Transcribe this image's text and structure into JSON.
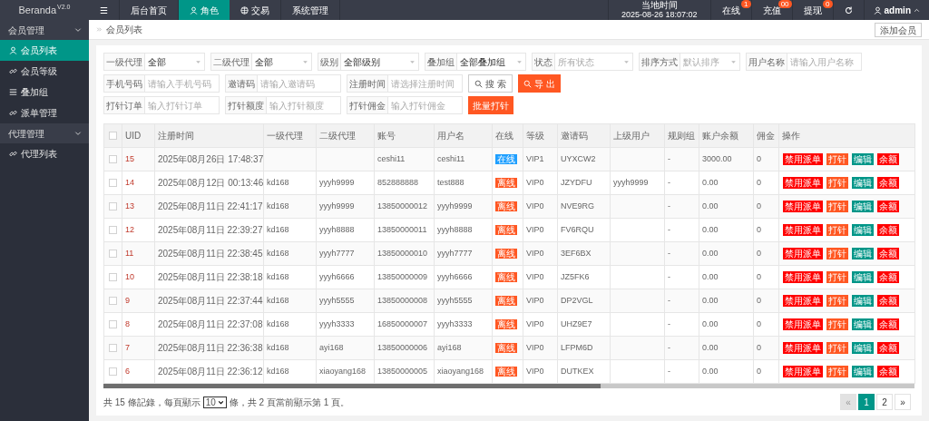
{
  "brand": {
    "name": "Beranda",
    "version": "V2.0"
  },
  "top_nav": {
    "items": [
      {
        "kind": "menu",
        "label": "☰",
        "selected": false
      },
      {
        "kind": "text",
        "label": "后台首页",
        "selected": false
      },
      {
        "kind": "person",
        "label": "角色",
        "selected": true
      },
      {
        "kind": "globe",
        "label": "交易",
        "selected": false
      },
      {
        "kind": "text",
        "label": "系统管理",
        "selected": false
      }
    ],
    "clock_label": "当地时间",
    "clock": "2025-08-26 18:07:02",
    "counters": [
      {
        "label": "在线",
        "badge": "1"
      },
      {
        "label": "充值",
        "badge": "00"
      },
      {
        "label": "提现",
        "badge": "0"
      }
    ],
    "user": "admin"
  },
  "sidebar": {
    "groups": [
      {
        "label": "会员管理",
        "expanded": true,
        "children": [
          {
            "kind": "person",
            "label": "会员列表",
            "selected": true
          },
          {
            "kind": "link",
            "label": "会员等级",
            "selected": false
          },
          {
            "kind": "list",
            "label": "叠加组",
            "selected": false
          },
          {
            "kind": "link",
            "label": "派单管理",
            "selected": false
          }
        ]
      },
      {
        "label": "代理管理",
        "expanded": true,
        "children": [
          {
            "kind": "link",
            "label": "代理列表",
            "selected": false
          }
        ]
      }
    ]
  },
  "breadcrumb": "会员列表",
  "add_button": "添加会员",
  "filters": [
    [
      {
        "kind": "select",
        "label": "一级代理",
        "value": "全部"
      },
      {
        "kind": "select",
        "label": "二级代理",
        "value": "全部"
      },
      {
        "kind": "select",
        "label": "级别",
        "value": "全部级别"
      },
      {
        "kind": "select",
        "label": "叠加组",
        "value": "全部叠加组"
      },
      {
        "kind": "select",
        "label": "状态",
        "placeholder": "所有状态"
      },
      {
        "kind": "select",
        "label": "排序方式",
        "placeholder": "默认排序"
      },
      {
        "kind": "input",
        "label": "用户名称",
        "placeholder": "请输入用户名称"
      }
    ],
    [
      {
        "kind": "input",
        "label": "手机号码",
        "placeholder": "请输入手机号码"
      },
      {
        "kind": "input",
        "label": "邀请码",
        "placeholder": "请输入邀请码"
      },
      {
        "kind": "input",
        "label": "注册时间",
        "placeholder": "请选择注册时间"
      },
      {
        "kind": "search",
        "label": "搜 索"
      },
      {
        "kind": "export",
        "label": "导 出"
      }
    ],
    [
      {
        "kind": "input",
        "label": "打针订单",
        "placeholder": "输入打针订单"
      },
      {
        "kind": "input",
        "label": "打针额度",
        "placeholder": "输入打针额度"
      },
      {
        "kind": "input",
        "label": "打针佣金",
        "placeholder": "输入打针佣金"
      },
      {
        "kind": "batch",
        "label": "批量打针"
      }
    ]
  ],
  "table": {
    "header_checked": false,
    "columns": [
      "UID",
      "注册时间",
      "一级代理",
      "二级代理",
      "账号",
      "用户名",
      "在线",
      "等级",
      "邀请码",
      "上级用户",
      "规则组",
      "账户余额",
      "佣金",
      "操作"
    ],
    "rows": [
      {
        "checked": false,
        "uid": "15",
        "time": "2025年08月26日 17:48:37",
        "account": "ceshi11",
        "username": "ceshi11",
        "online": true,
        "status": "在线",
        "level": "VIP1",
        "code": "UYXCW2",
        "rule": "-",
        "balance": "3000.00",
        "commission": "0",
        "actions": [
          {
            "kind": "disable",
            "label": "禁用派单"
          },
          {
            "kind": "inject",
            "label": "打针"
          },
          {
            "kind": "edit",
            "label": "编辑"
          },
          {
            "kind": "balance",
            "label": "余额"
          }
        ]
      },
      {
        "checked": false,
        "uid": "14",
        "time": "2025年08月12日 00:13:46",
        "agent1": "kd168",
        "agent2": "yyyh9999",
        "account": "852888888",
        "username": "test888",
        "online": false,
        "status": "离线",
        "level": "VIP0",
        "code": "JZYDFU",
        "parent": "yyyh9999",
        "rule": "-",
        "balance": "0.00",
        "commission": "0",
        "actions": [
          {
            "kind": "disable",
            "label": "禁用派单"
          },
          {
            "kind": "inject",
            "label": "打针"
          },
          {
            "kind": "edit",
            "label": "编辑"
          },
          {
            "kind": "balance",
            "label": "余额"
          }
        ]
      },
      {
        "checked": false,
        "uid": "13",
        "time": "2025年08月11日 22:41:17",
        "agent1": "kd168",
        "agent2": "yyyh9999",
        "account": "13850000012",
        "username": "yyyh9999",
        "online": false,
        "status": "离线",
        "level": "VIP0",
        "code": "NVE9RG",
        "rule": "-",
        "balance": "0.00",
        "commission": "0",
        "actions": [
          {
            "kind": "disable",
            "label": "禁用派单"
          },
          {
            "kind": "inject",
            "label": "打针"
          },
          {
            "kind": "edit",
            "label": "编辑"
          },
          {
            "kind": "balance",
            "label": "余额"
          }
        ]
      },
      {
        "checked": false,
        "uid": "12",
        "time": "2025年08月11日 22:39:27",
        "agent1": "kd168",
        "agent2": "yyyh8888",
        "account": "13850000011",
        "username": "yyyh8888",
        "online": false,
        "status": "离线",
        "level": "VIP0",
        "code": "FV6RQU",
        "rule": "-",
        "balance": "0.00",
        "commission": "0",
        "actions": [
          {
            "kind": "disable",
            "label": "禁用派单"
          },
          {
            "kind": "inject",
            "label": "打针"
          },
          {
            "kind": "edit",
            "label": "编辑"
          },
          {
            "kind": "balance",
            "label": "余额"
          }
        ]
      },
      {
        "checked": false,
        "uid": "11",
        "time": "2025年08月11日 22:38:45",
        "agent1": "kd168",
        "agent2": "yyyh7777",
        "account": "13850000010",
        "username": "yyyh7777",
        "online": false,
        "status": "离线",
        "level": "VIP0",
        "code": "3EF6BX",
        "rule": "-",
        "balance": "0.00",
        "commission": "0",
        "actions": [
          {
            "kind": "disable",
            "label": "禁用派单"
          },
          {
            "kind": "inject",
            "label": "打针"
          },
          {
            "kind": "edit",
            "label": "编辑"
          },
          {
            "kind": "balance",
            "label": "余额"
          }
        ]
      },
      {
        "checked": false,
        "uid": "10",
        "time": "2025年08月11日 22:38:18",
        "agent1": "kd168",
        "agent2": "yyyh6666",
        "account": "13850000009",
        "username": "yyyh6666",
        "online": false,
        "status": "离线",
        "level": "VIP0",
        "code": "JZ5FK6",
        "rule": "-",
        "balance": "0.00",
        "commission": "0",
        "actions": [
          {
            "kind": "disable",
            "label": "禁用派单"
          },
          {
            "kind": "inject",
            "label": "打针"
          },
          {
            "kind": "edit",
            "label": "编辑"
          },
          {
            "kind": "balance",
            "label": "余额"
          }
        ]
      },
      {
        "checked": false,
        "uid": "9",
        "time": "2025年08月11日 22:37:44",
        "agent1": "kd168",
        "agent2": "yyyh5555",
        "account": "13850000008",
        "username": "yyyh5555",
        "online": false,
        "status": "离线",
        "level": "VIP0",
        "code": "DP2VGL",
        "rule": "-",
        "balance": "0.00",
        "commission": "0",
        "actions": [
          {
            "kind": "disable",
            "label": "禁用派单"
          },
          {
            "kind": "inject",
            "label": "打针"
          },
          {
            "kind": "edit",
            "label": "编辑"
          },
          {
            "kind": "balance",
            "label": "余额"
          }
        ]
      },
      {
        "checked": false,
        "uid": "8",
        "time": "2025年08月11日 22:37:08",
        "agent1": "kd168",
        "agent2": "yyyh3333",
        "account": "16850000007",
        "username": "yyyh3333",
        "online": false,
        "status": "离线",
        "level": "VIP0",
        "code": "UHZ9E7",
        "rule": "-",
        "balance": "0.00",
        "commission": "0",
        "actions": [
          {
            "kind": "disable",
            "label": "禁用派单"
          },
          {
            "kind": "inject",
            "label": "打针"
          },
          {
            "kind": "edit",
            "label": "编辑"
          },
          {
            "kind": "balance",
            "label": "余额"
          }
        ]
      },
      {
        "checked": false,
        "uid": "7",
        "time": "2025年08月11日 22:36:38",
        "agent1": "kd168",
        "agent2": "ayi168",
        "account": "13850000006",
        "username": "ayi168",
        "online": false,
        "status": "离线",
        "level": "VIP0",
        "code": "LFPM6D",
        "rule": "-",
        "balance": "0.00",
        "commission": "0",
        "actions": [
          {
            "kind": "disable",
            "label": "禁用派单"
          },
          {
            "kind": "inject",
            "label": "打针"
          },
          {
            "kind": "edit",
            "label": "编辑"
          },
          {
            "kind": "balance",
            "label": "余额"
          }
        ]
      },
      {
        "checked": false,
        "uid": "6",
        "time": "2025年08月11日 22:36:12",
        "agent1": "kd168",
        "agent2": "xiaoyang168",
        "account": "13850000005",
        "username": "xiaoyang168",
        "online": false,
        "status": "离线",
        "level": "VIP0",
        "code": "DUTKEX",
        "rule": "-",
        "balance": "0.00",
        "commission": "0",
        "actions": [
          {
            "kind": "disable",
            "label": "禁用派单"
          },
          {
            "kind": "inject",
            "label": "打针"
          },
          {
            "kind": "edit",
            "label": "编辑"
          },
          {
            "kind": "balance",
            "label": "余额"
          }
        ]
      }
    ]
  },
  "footer": {
    "before": "共 15 條記錄，每頁顯示",
    "page_size": "10",
    "after": "條，共 2 頁當前顯示第 1 頁。"
  },
  "pagination": [
    {
      "label": "«",
      "selected": false,
      "disabled": true
    },
    {
      "label": "1",
      "selected": true,
      "disabled": false
    },
    {
      "label": "2",
      "selected": false,
      "disabled": false
    },
    {
      "label": "»",
      "selected": false,
      "disabled": false
    }
  ]
}
